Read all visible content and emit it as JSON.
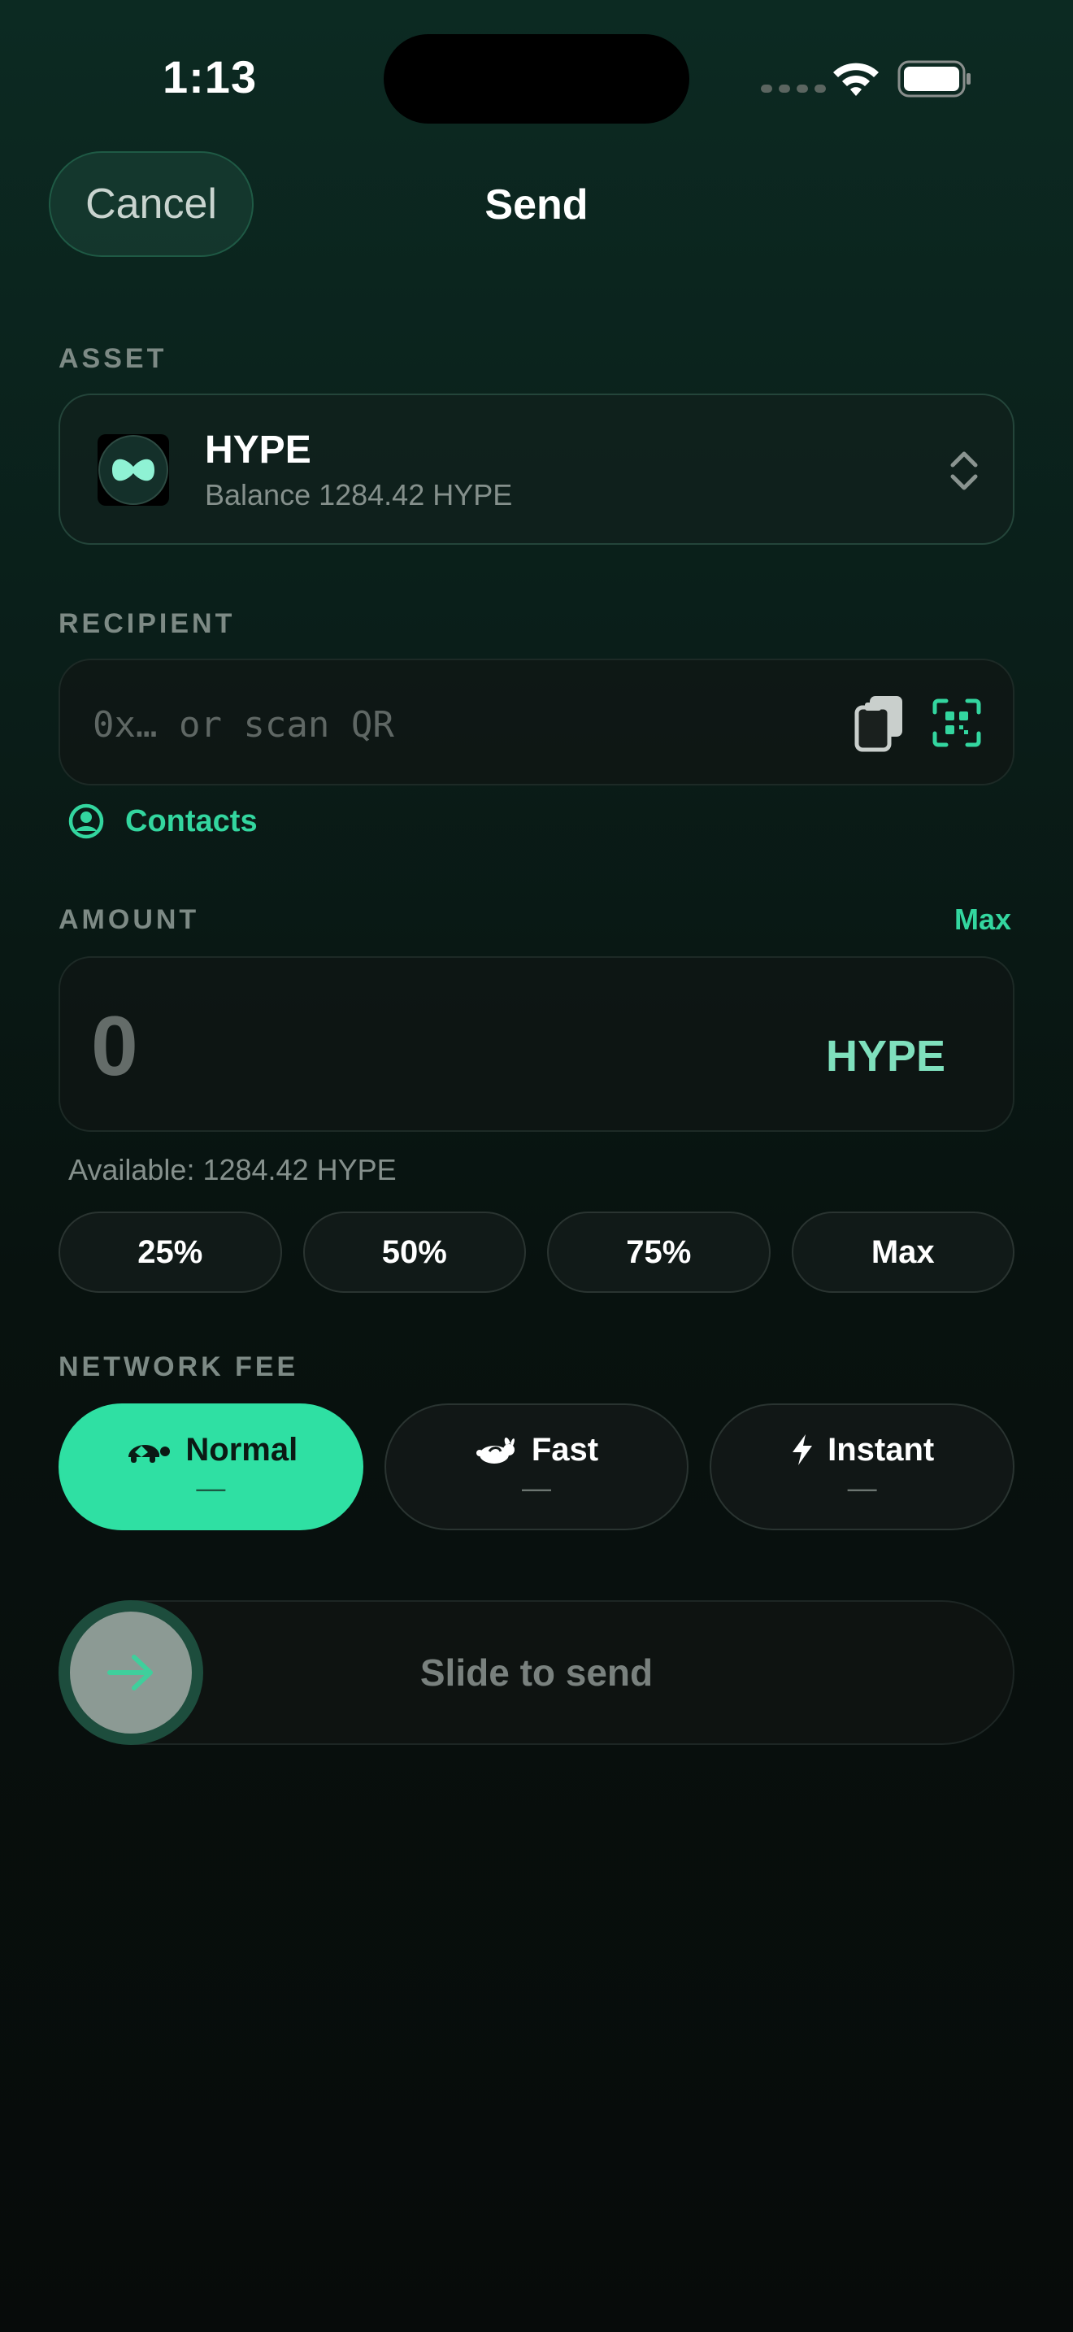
{
  "status_bar": {
    "time": "1:13"
  },
  "header": {
    "cancel_label": "Cancel",
    "title": "Send"
  },
  "asset": {
    "section_label": "ASSET",
    "name": "HYPE",
    "balance_text": "Balance 1284.42 HYPE",
    "icon": "hype-logo-icon"
  },
  "recipient": {
    "section_label": "RECIPIENT",
    "placeholder": "0x… or scan QR",
    "value": "",
    "contacts_label": "Contacts"
  },
  "amount": {
    "section_label": "AMOUNT",
    "max_link": "Max",
    "value": "0",
    "unit": "HYPE",
    "available_text": "Available: 1284.42 HYPE",
    "quick_options": [
      "25%",
      "50%",
      "75%",
      "Max"
    ]
  },
  "network_fee": {
    "section_label": "NETWORK FEE",
    "selected": "Normal",
    "options": [
      {
        "label": "Normal",
        "value": "—",
        "icon": "turtle-icon"
      },
      {
        "label": "Fast",
        "value": "—",
        "icon": "rabbit-icon"
      },
      {
        "label": "Instant",
        "value": "—",
        "icon": "bolt-icon"
      }
    ]
  },
  "slider": {
    "label": "Slide to send",
    "progress": 0
  },
  "colors": {
    "accent": "#2fe0a3",
    "accent_text": "#33d69f",
    "background_top": "#0c2a22",
    "background_bottom": "#070b0a"
  }
}
